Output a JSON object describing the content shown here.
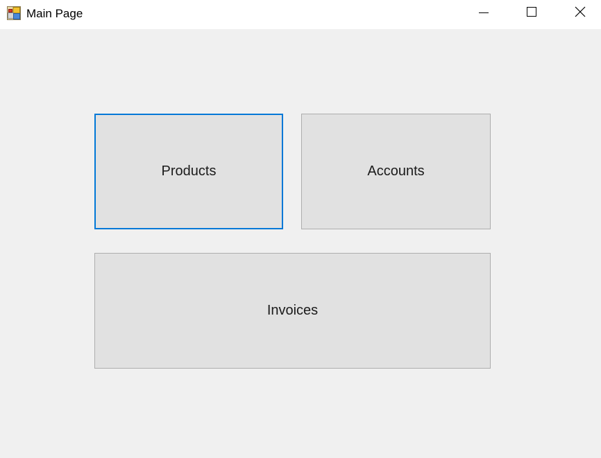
{
  "window": {
    "title": "Main Page",
    "app_icon": "winforms-app-icon",
    "controls": {
      "minimize_icon": "minimize-icon",
      "maximize_icon": "maximize-icon",
      "close_icon": "close-icon"
    }
  },
  "buttons": {
    "products": {
      "label": "Products",
      "focused": true
    },
    "accounts": {
      "label": "Accounts",
      "focused": false
    },
    "invoices": {
      "label": "Invoices",
      "focused": false
    }
  },
  "colors": {
    "form_background": "#f0f0f0",
    "button_background": "#e1e1e1",
    "button_border": "#adadad",
    "focus_border": "#0078d7"
  }
}
